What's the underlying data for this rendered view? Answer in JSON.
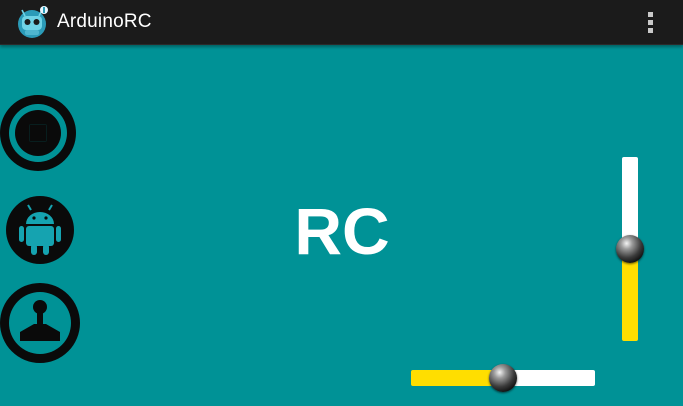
{
  "app": {
    "title": "ArduinoRC",
    "icon": "arduino-robot-icon",
    "menu_icon": "overflow-menu-icon"
  },
  "side_buttons": [
    {
      "name": "stop-button",
      "icon": "stop-icon"
    },
    {
      "name": "android-button",
      "icon": "android-icon"
    },
    {
      "name": "joystick-button",
      "icon": "joystick-icon"
    }
  ],
  "center_label": "RC",
  "vertical_slider": {
    "value_fraction": 0.5
  },
  "horizontal_slider": {
    "value_fraction": 0.5
  },
  "colors": {
    "background": "#009296",
    "action_bar": "#1b1b1b",
    "track_fill": "#ffde00",
    "track_empty": "#ffffff",
    "button_dark": "#0a0a0a"
  }
}
